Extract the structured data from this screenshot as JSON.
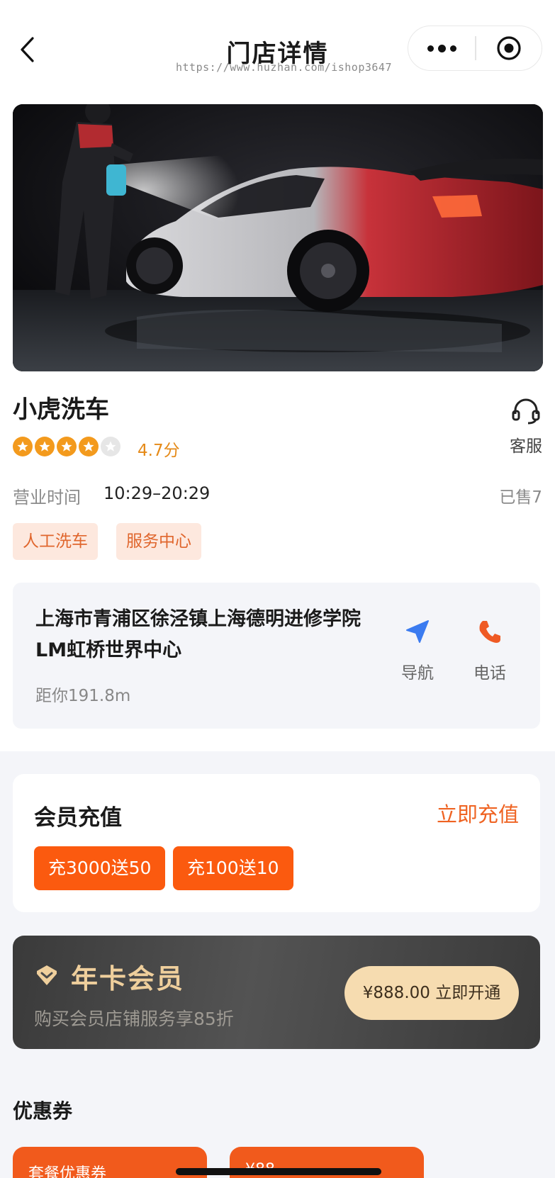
{
  "nav": {
    "title": "门店详情",
    "watermark": "https://www.huzhan.com/ishop3647",
    "icons": {
      "back": "chevron-left-icon",
      "more": "more-dots-icon",
      "close": "target-circle-icon"
    }
  },
  "store": {
    "name": "小虎洗车",
    "service_label": "客服",
    "rating_text": "4.7分",
    "stars_filled": 4,
    "stars_total": 5,
    "hours_label": "营业时间",
    "hours_value": "10:29–20:29",
    "sold": "已售7",
    "tags": [
      "人工洗车",
      "服务中心"
    ]
  },
  "address": {
    "text": "上海市青浦区徐泾镇上海德明进修学院LM虹桥世界中心",
    "distance": "距你191.8m",
    "navigate_label": "导航",
    "phone_label": "电话"
  },
  "member_recharge": {
    "title": "会员充值",
    "action": "立即充值",
    "options": [
      "充3000送50",
      "充100送10"
    ]
  },
  "vip": {
    "title": "年卡会员",
    "desc": "购买会员店铺服务享85折",
    "button": "¥888.00 立即开通"
  },
  "coupons": {
    "title": "优惠券",
    "items": [
      "套餐优惠券",
      "¥88"
    ]
  },
  "colors": {
    "accent": "#fb5a0f",
    "star": "#f39a1d",
    "gold": "#efcf9c",
    "navigate_blue": "#3b7bf0"
  }
}
